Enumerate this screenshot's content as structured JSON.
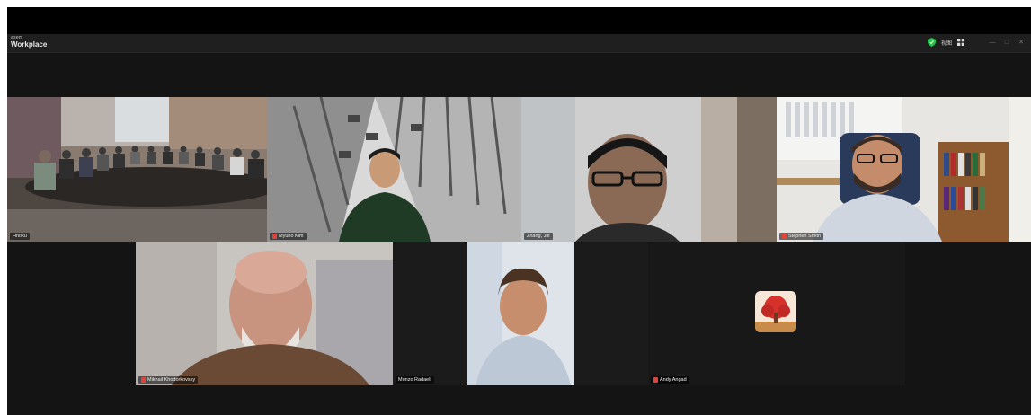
{
  "app": {
    "brand_small": "asem",
    "brand_title": "Workplace",
    "view_label": "视图",
    "icons": [
      "shield-icon",
      "grid-view-icon",
      "minimize-icon",
      "maximize-icon",
      "close-icon"
    ]
  },
  "participants": [
    {
      "name": "Hnoku",
      "muted": false,
      "active": true
    },
    {
      "name": "Myuno Kim",
      "muted": true,
      "active": false
    },
    {
      "name": "Zhang, Jie",
      "muted": false,
      "active": false
    },
    {
      "name": "Stephen Smith",
      "muted": true,
      "active": false
    },
    {
      "name": "Mikhail Khodorkovsky",
      "muted": true,
      "active": false
    },
    {
      "name": "Munzo Radaeli",
      "muted": false,
      "active": false
    },
    {
      "name": "Andy Angad",
      "muted": true,
      "active": false
    }
  ],
  "colors": {
    "active_border": "#3ccf5a",
    "muted_icon": "#e0453c",
    "background": "#141414"
  }
}
